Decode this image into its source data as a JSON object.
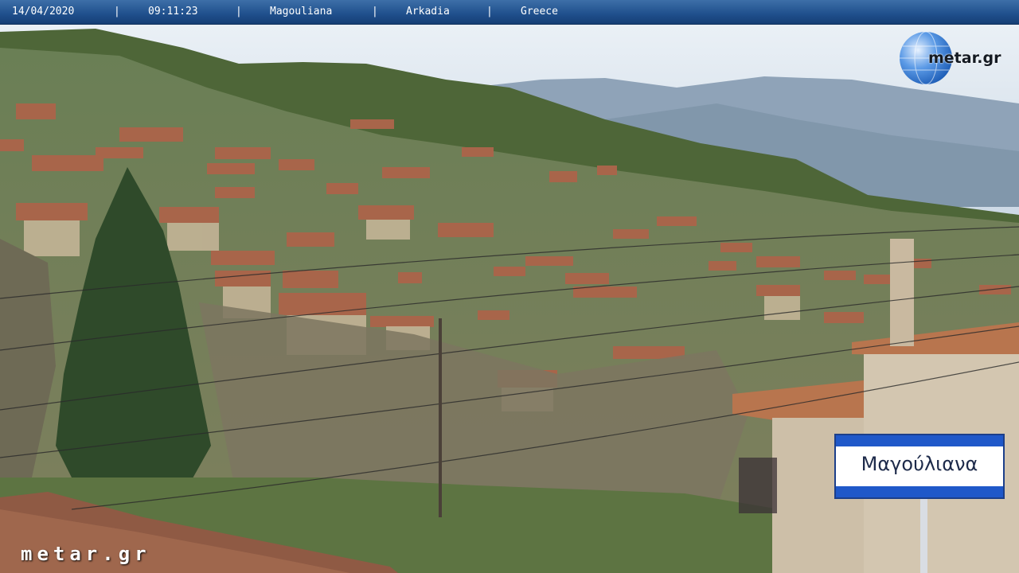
{
  "overlay": {
    "date": "14/04/2020",
    "time": "09:11:23",
    "village": "Magouliana",
    "region": "Arkadia",
    "country": "Greece",
    "separator": "|"
  },
  "logo": {
    "text": "metar.gr"
  },
  "watermark": {
    "text": "metar.gr"
  },
  "sign": {
    "text": "Μαγούλιανα"
  },
  "colors": {
    "bar_top": "#3d6fa8",
    "bar_bottom": "#163f75",
    "sky": "#dde8f2",
    "hills": "#4f6a3a",
    "roof": "#a8654a",
    "sign_blue": "#1f58c9"
  }
}
